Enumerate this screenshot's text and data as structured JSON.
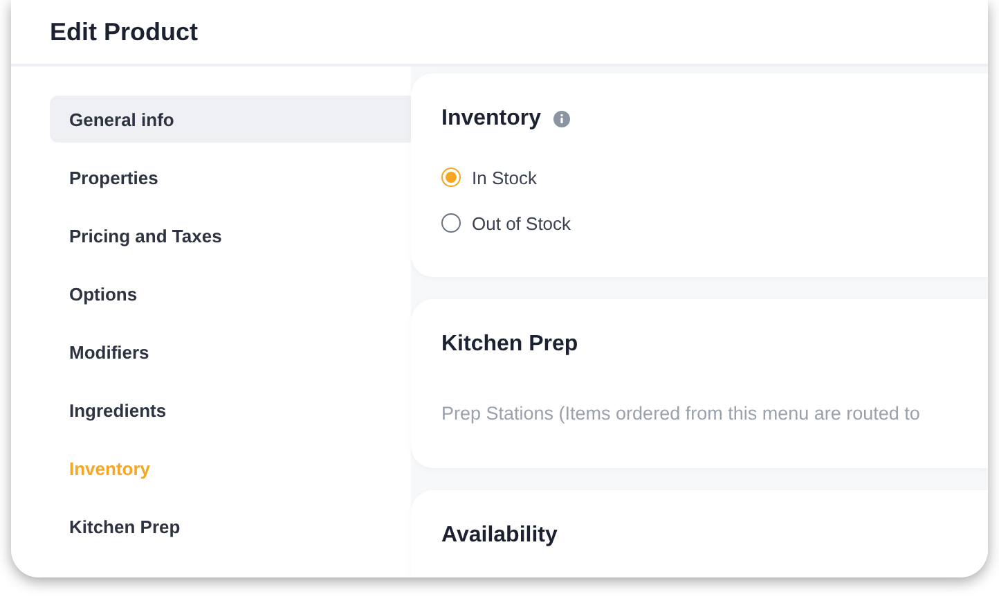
{
  "window": {
    "title": "Edit Product"
  },
  "sidebar": {
    "items": [
      {
        "label": "General info",
        "highlighted": true,
        "selected": false
      },
      {
        "label": "Properties",
        "highlighted": false,
        "selected": false
      },
      {
        "label": "Pricing and Taxes",
        "highlighted": false,
        "selected": false
      },
      {
        "label": "Options",
        "highlighted": false,
        "selected": false
      },
      {
        "label": "Modifiers",
        "highlighted": false,
        "selected": false
      },
      {
        "label": "Ingredients",
        "highlighted": false,
        "selected": false
      },
      {
        "label": "Inventory",
        "highlighted": false,
        "selected": true
      },
      {
        "label": "Kitchen Prep",
        "highlighted": false,
        "selected": false
      }
    ]
  },
  "sections": [
    {
      "kind": "radios",
      "title": "Inventory",
      "info": true,
      "options": [
        {
          "label": "In Stock",
          "selected": true
        },
        {
          "label": "Out of Stock",
          "selected": false
        }
      ]
    },
    {
      "kind": "text",
      "title": "Kitchen Prep",
      "info": false,
      "text": "Prep Stations (Items ordered from this menu are routed to"
    },
    {
      "kind": "empty",
      "title": "Availability",
      "info": false
    }
  ]
}
